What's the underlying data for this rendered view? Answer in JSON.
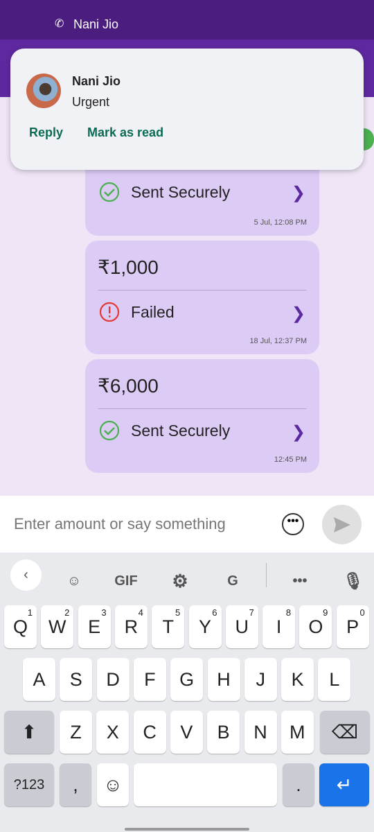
{
  "status_bar": {
    "notification_app": "Nani Jio"
  },
  "notification": {
    "sender": "Nani Jio",
    "message": "Urgent",
    "actions": [
      "Reply",
      "Mark as read"
    ]
  },
  "messages": [
    {
      "amount": "",
      "status": "Sent Securely",
      "status_type": "success",
      "time": "5 Jul, 12:08 PM"
    },
    {
      "amount": "₹1,000",
      "status": "Failed",
      "status_type": "failed",
      "time": "18 Jul, 12:37 PM"
    },
    {
      "amount": "₹6,000",
      "status": "Sent Securely",
      "status_type": "success",
      "time": "12:45 PM"
    }
  ],
  "input": {
    "placeholder": "Enter amount or say something"
  },
  "keyboard": {
    "toolbar": {
      "gif": "GIF"
    },
    "row1": [
      [
        "Q",
        "1"
      ],
      [
        "W",
        "2"
      ],
      [
        "E",
        "3"
      ],
      [
        "R",
        "4"
      ],
      [
        "T",
        "5"
      ],
      [
        "Y",
        "6"
      ],
      [
        "U",
        "7"
      ],
      [
        "I",
        "8"
      ],
      [
        "O",
        "9"
      ],
      [
        "P",
        "0"
      ]
    ],
    "row2": [
      "A",
      "S",
      "D",
      "F",
      "G",
      "H",
      "J",
      "K",
      "L"
    ],
    "row3": [
      "Z",
      "X",
      "C",
      "V",
      "B",
      "N",
      "M"
    ],
    "symbols": "?123",
    "comma": ",",
    "period": "."
  },
  "colors": {
    "accent": "#5e29a0",
    "success": "#4caf50",
    "failed": "#e53935",
    "action": "#0b6b55"
  }
}
